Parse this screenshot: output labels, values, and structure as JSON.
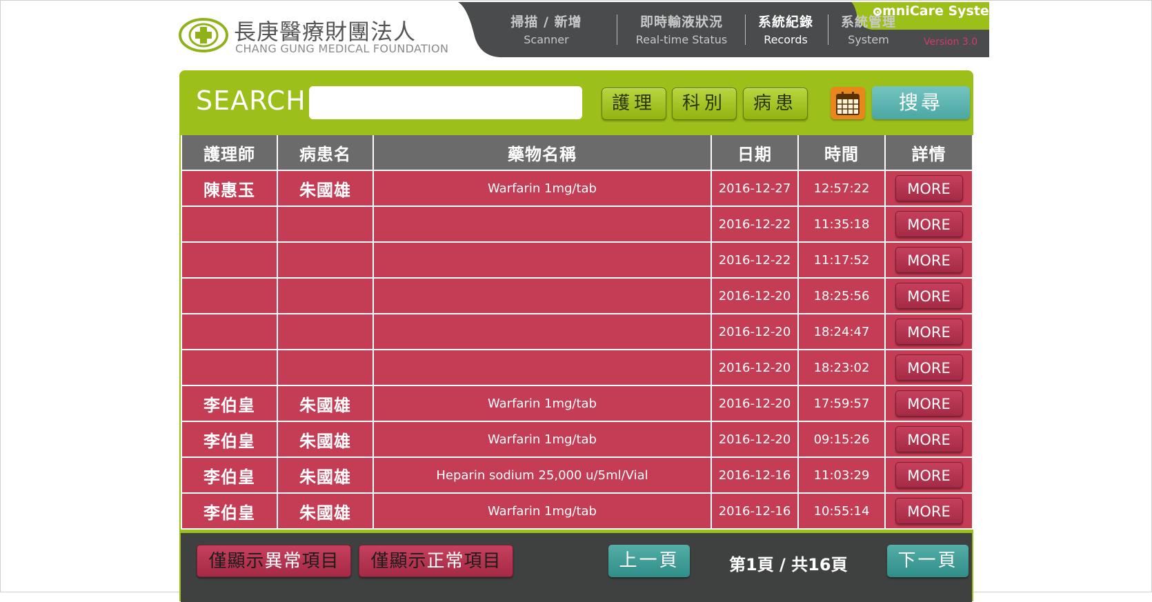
{
  "logo": {
    "name_cn": "長庚醫療財團法人",
    "name_en": "CHANG GUNG MEDICAL FOUNDATION"
  },
  "nav": {
    "items": [
      {
        "cn": "掃描 / 新增",
        "en": "Scanner"
      },
      {
        "cn": "即時輸液狀況",
        "en": "Real-time Status"
      },
      {
        "cn": "系統紀錄",
        "en": "Records"
      },
      {
        "cn": "系統管理",
        "en": "System"
      }
    ],
    "active": "Records",
    "brand": "mniCare System",
    "version": "Version 3.0"
  },
  "search": {
    "label": "SEARCH",
    "value": "",
    "filters": [
      "護理",
      "科別",
      "病患"
    ],
    "calendar_icon": "calendar-icon",
    "submit_label": "搜尋"
  },
  "table": {
    "headers": [
      "護理師",
      "病患名",
      "藥物名稱",
      "日期",
      "時間",
      "詳情"
    ],
    "rows": [
      {
        "nurse": "陳惠玉",
        "patient": "朱國雄",
        "drug": "Warfarin 1mg/tab",
        "date": "2016-12-27",
        "time": "12:57:22",
        "action": "MORE"
      },
      {
        "nurse": "",
        "patient": "",
        "drug": "",
        "date": "2016-12-22",
        "time": "11:35:18",
        "action": "MORE"
      },
      {
        "nurse": "",
        "patient": "",
        "drug": "",
        "date": "2016-12-22",
        "time": "11:17:52",
        "action": "MORE"
      },
      {
        "nurse": "",
        "patient": "",
        "drug": "",
        "date": "2016-12-20",
        "time": "18:25:56",
        "action": "MORE"
      },
      {
        "nurse": "",
        "patient": "",
        "drug": "",
        "date": "2016-12-20",
        "time": "18:24:47",
        "action": "MORE"
      },
      {
        "nurse": "",
        "patient": "",
        "drug": "",
        "date": "2016-12-20",
        "time": "18:23:02",
        "action": "MORE"
      },
      {
        "nurse": "李伯皇",
        "patient": "朱國雄",
        "drug": "Warfarin 1mg/tab",
        "date": "2016-12-20",
        "time": "17:59:57",
        "action": "MORE"
      },
      {
        "nurse": "李伯皇",
        "patient": "朱國雄",
        "drug": "Warfarin 1mg/tab",
        "date": "2016-12-20",
        "time": "09:15:26",
        "action": "MORE"
      },
      {
        "nurse": "李伯皇",
        "patient": "朱國雄",
        "drug": "Heparin sodium 25,000 u/5ml/Vial",
        "date": "2016-12-16",
        "time": "11:03:29",
        "action": "MORE"
      },
      {
        "nurse": "李伯皇",
        "patient": "朱國雄",
        "drug": "Warfarin 1mg/tab",
        "date": "2016-12-16",
        "time": "10:55:14",
        "action": "MORE"
      }
    ]
  },
  "footer": {
    "abnormal": {
      "p1": "僅顯示",
      "p2": "異常",
      "p3": "項目"
    },
    "normal": {
      "p1": "僅顯示",
      "p2": "正常",
      "p3": "項目"
    },
    "prev_label": "上一頁",
    "next_label": "下一頁",
    "page_info": "第1頁 / 共16頁"
  },
  "colors": {
    "accent_green": "#9dbf1a",
    "row_red": "#c53c55",
    "header_gray": "#6b6b6b",
    "footer_dark": "#3f4040",
    "teal": "#4aa7a3"
  }
}
